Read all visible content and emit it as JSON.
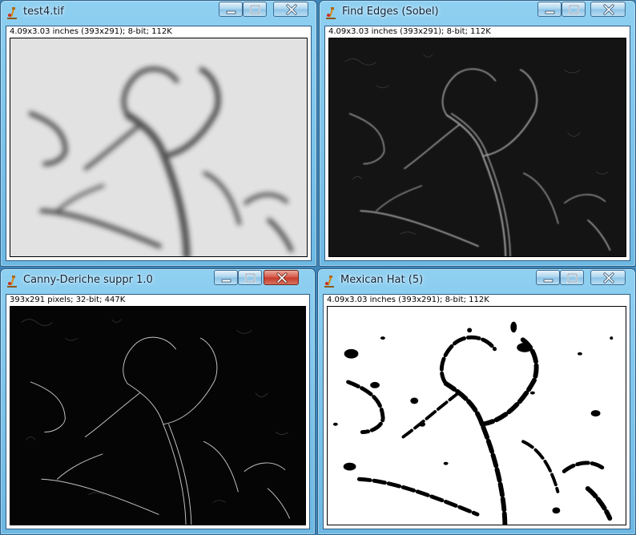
{
  "windows": [
    {
      "title": "test4.tif",
      "info": "4.09x3.03 inches (393x291); 8-bit; 112K",
      "image_desc": "blurred grayscale micrograph"
    },
    {
      "title": "Find Edges (Sobel)",
      "info": "4.09x3.03 inches (393x291); 8-bit; 112K",
      "image_desc": "sobel edge result"
    },
    {
      "title": "Canny-Deriche suppr 1.0",
      "info": "393x291 pixels; 32-bit; 447K",
      "image_desc": "thin edge lines"
    },
    {
      "title": "Mexican Hat (5)",
      "info": "4.09x3.03 inches (393x291); 8-bit; 112K",
      "image_desc": "binary thresholded branches"
    }
  ],
  "icons": {
    "app": "imagej-microscope-icon",
    "minimize": "minimize-icon",
    "maximize": "maximize-icon",
    "close": "close-icon"
  },
  "colors": {
    "desktop": "#3f86b8",
    "close_active": "#c63a2b"
  }
}
